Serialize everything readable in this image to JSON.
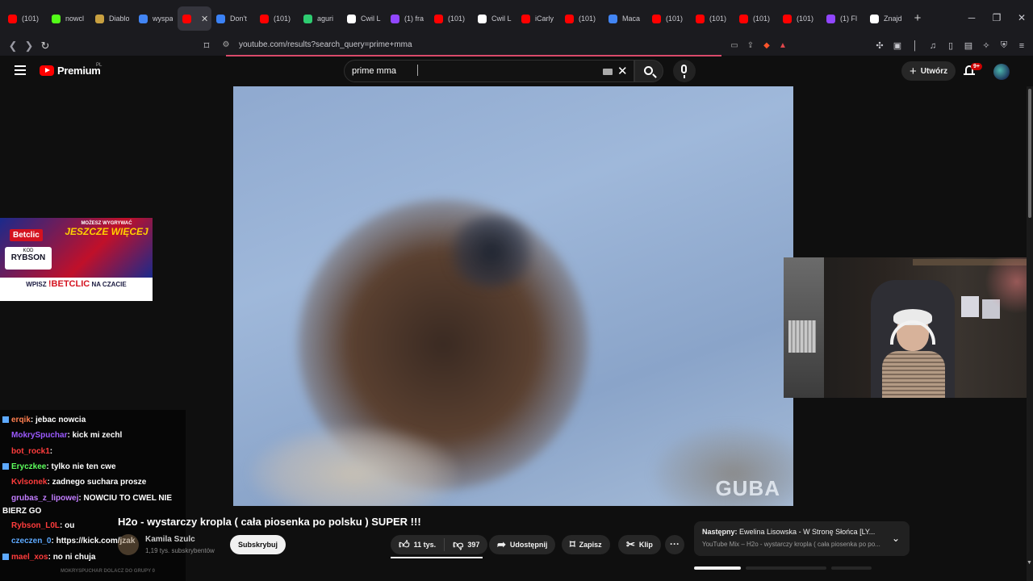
{
  "browser": {
    "tabs": [
      {
        "label": "(101)",
        "color": "#ff0000"
      },
      {
        "label": "nowcl",
        "color": "#53fc18"
      },
      {
        "label": "Diablo",
        "color": "#c8a040"
      },
      {
        "label": "wyspa",
        "color": "#4285f4"
      },
      {
        "label": "(1",
        "color": "#ff0000",
        "active": true
      },
      {
        "label": "Don't",
        "color": "#3b82f6"
      },
      {
        "label": "(101)",
        "color": "#ff0000"
      },
      {
        "label": "aguri",
        "color": "#2ecc71"
      },
      {
        "label": "Cwil L",
        "color": "#ffffff"
      },
      {
        "label": "(1) fra",
        "color": "#9146ff"
      },
      {
        "label": "(101)",
        "color": "#ff0000"
      },
      {
        "label": "Cwil L",
        "color": "#ffffff"
      },
      {
        "label": "iCarly",
        "color": "#ff0000"
      },
      {
        "label": "(101)",
        "color": "#ff0000"
      },
      {
        "label": "Maca",
        "color": "#4285f4"
      },
      {
        "label": "(101)",
        "color": "#ff0000"
      },
      {
        "label": "(101)",
        "color": "#ff0000"
      },
      {
        "label": "(101)",
        "color": "#ff0000"
      },
      {
        "label": "(101)",
        "color": "#ff0000"
      },
      {
        "label": "(1) Fl",
        "color": "#9146ff"
      },
      {
        "label": "Znajd",
        "color": "#ffffff"
      }
    ],
    "url": "youtube.com/results?search_query=prime+mma"
  },
  "youtube": {
    "logo_text": "Premium",
    "logo_region": "PL",
    "search_value": "prime mma",
    "create_label": "Utwórz",
    "notif_badge": "9+"
  },
  "video": {
    "watermark": "GUBA",
    "title": "H2o - wystarczy kropla ( cała piosenka po polsku ) SUPER !!!",
    "channel": "Kamila Szulc",
    "subs": "1,19 tys. subskrybentów",
    "subscribe_label": "Subskrybuj",
    "likes": "11 tys.",
    "dislikes": "397",
    "share_label": "Udostępnij",
    "save_label": "Zapisz",
    "clip_label": "Klip"
  },
  "next": {
    "prefix": "Następny:",
    "title": "Ewelina Lisowska - W Stronę Słońca [LY...",
    "subtitle": "YouTube Mix – H2o - wystarczy kropla ( cała piosenka po po..."
  },
  "ad": {
    "brand": "Betclic",
    "code_label": "KOD",
    "code_name": "RYBSON",
    "headline_top": "MOŻESZ WYGRYWAĆ",
    "headline_big": "JESZCZE WIĘCEJ",
    "bottom_pre": "WPISZ",
    "bottom_code": "!BETCLIC",
    "bottom_post": "NA CZACIE"
  },
  "chat": [
    {
      "user": "erqik",
      "color": "#ff7f50",
      "msg": ": jebac nowcia"
    },
    {
      "user": "MokrySpuchar",
      "color": "#9b59ff",
      "msg": ": kick mi zechl"
    },
    {
      "user": "bot_rock1",
      "color": "#ff3c3c",
      "msg": ":"
    },
    {
      "user": "Eryczkee",
      "color": "#5dff5d",
      "msg": ": tylko nie ten cwe"
    },
    {
      "user": "Kvlsonek",
      "color": "#ff3c3c",
      "msg": ": zadnego suchara prosze"
    },
    {
      "user": "grubas_z_lipowej",
      "color": "#c27dff",
      "msg": ": NOWCIU TO CWEL NIE"
    },
    {
      "user": "",
      "color": "#ffffff",
      "msg": "BIERZ GO"
    },
    {
      "user": "Rybson_L0L",
      "color": "#ff3c3c",
      "msg": ": ou"
    },
    {
      "user": "czeczen_0",
      "color": "#5da9ff",
      "msg": ": https://kick.com/jzak"
    },
    {
      "user": "mael_xos",
      "color": "#ff3c3c",
      "msg": ": no ni chuja"
    }
  ],
  "chat_faded": "MOKRYSPUCHAR DOLACZ DO GRUPY 0"
}
